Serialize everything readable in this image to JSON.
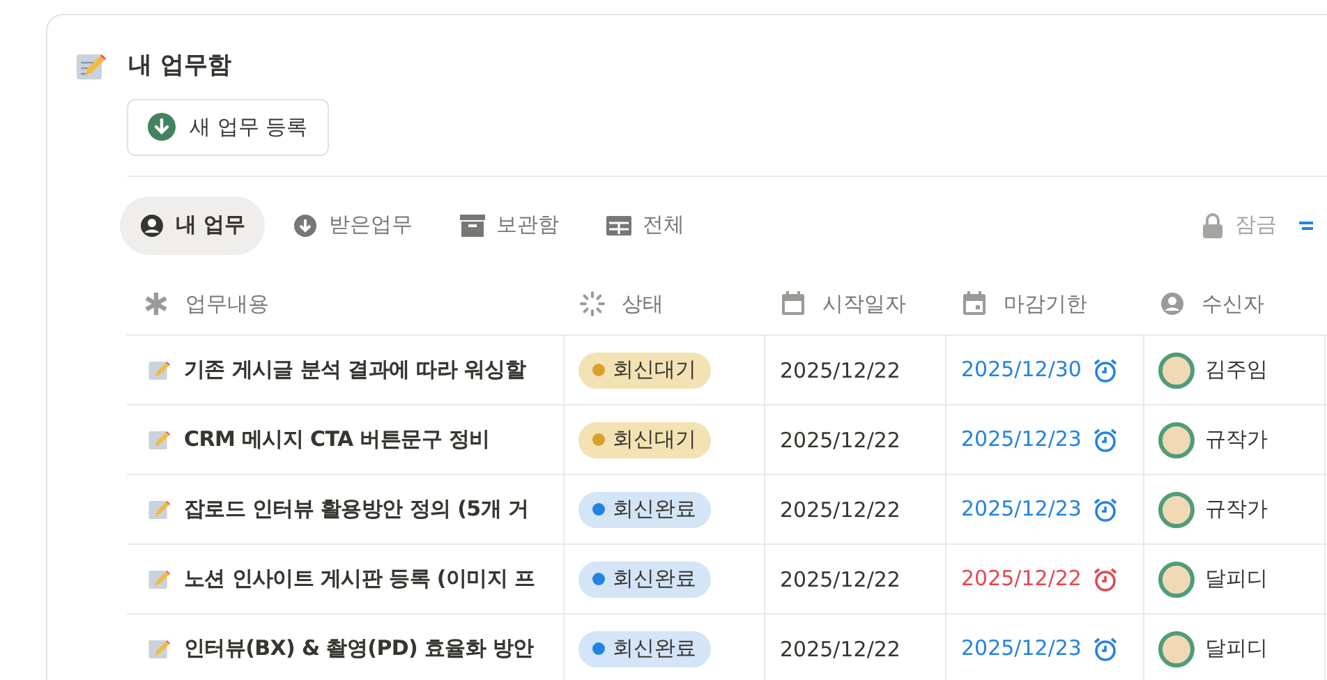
{
  "page": {
    "title": "내 업무함"
  },
  "new_button": {
    "label": "새 업무 등록"
  },
  "tabs": [
    {
      "label": "내 업무",
      "kind": "person",
      "selected": true
    },
    {
      "label": "받은업무",
      "kind": "download",
      "selected": false
    },
    {
      "label": "보관함",
      "kind": "archive",
      "selected": false
    },
    {
      "label": "전체",
      "kind": "table",
      "selected": false
    }
  ],
  "lock": {
    "label": "잠금"
  },
  "table": {
    "columns": [
      {
        "label": "업무내용",
        "kind": "asterisk"
      },
      {
        "label": "상태",
        "kind": "spinner"
      },
      {
        "label": "시작일자",
        "kind": "calendar"
      },
      {
        "label": "마감기한",
        "kind": "calendar-due"
      },
      {
        "label": "수신자",
        "kind": "person"
      }
    ],
    "rows": [
      {
        "task": "기존 게시글 분석 결과에 따라 워싱할",
        "status": "회신대기",
        "color": "#d9a12b",
        "start": "2025/12/22",
        "due": "2025/12/30",
        "overdue": false,
        "assignee": "김주임"
      },
      {
        "task": "CRM 메시지 CTA 버튼문구 정비",
        "status": "회신대기",
        "color": "#d9a12b",
        "start": "2025/12/22",
        "due": "2025/12/23",
        "overdue": false,
        "assignee": "규작가"
      },
      {
        "task": "잡로드 인터뷰 활용방안 정의 (5개 거",
        "status": "회신완료",
        "color": "#2383e2",
        "start": "2025/12/22",
        "due": "2025/12/23",
        "overdue": false,
        "assignee": "규작가"
      },
      {
        "task": "노션 인사이트 게시판 등록 (이미지 프",
        "status": "회신완료",
        "color": "#2383e2",
        "start": "2025/12/22",
        "due": "2025/12/22",
        "overdue": true,
        "assignee": "달피디"
      },
      {
        "task": "인터뷰(BX) & 촬영(PD) 효율화 방안",
        "status": "회신완료",
        "color": "#2383e2",
        "start": "2025/12/22",
        "due": "2025/12/23",
        "overdue": false,
        "assignee": "달피디"
      }
    ]
  }
}
